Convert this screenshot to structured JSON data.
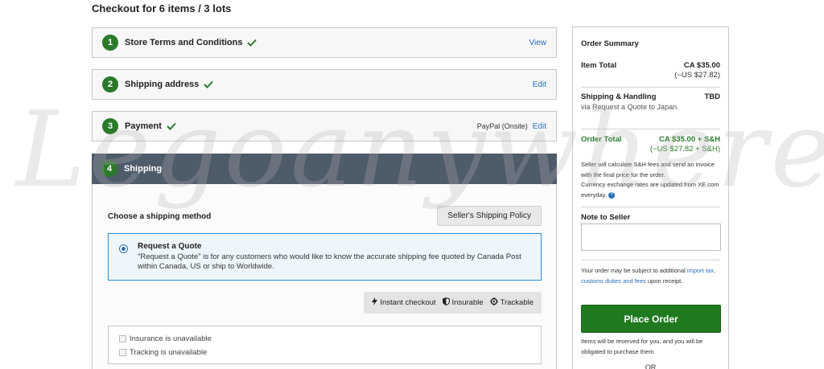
{
  "page": {
    "title": "Checkout for 6 items / 3 lots"
  },
  "steps": [
    {
      "num": "1",
      "label": "Store Terms and Conditions",
      "extra": "",
      "link": "View"
    },
    {
      "num": "2",
      "label": "Shipping address",
      "extra": "",
      "link": "Edit"
    },
    {
      "num": "3",
      "label": "Payment",
      "extra": "PayPal (Onsite)",
      "link": "Edit"
    },
    {
      "num": "4",
      "label": "Shipping"
    }
  ],
  "shipping": {
    "choose_label": "Choose a shipping method",
    "policy_button": "Seller's Shipping Policy",
    "option": {
      "title": "Request a Quote",
      "description": "\"Request a Quote\" is for any customers who would like to know the accurate shipping fee quoted by Canada Post within Canada, US or ship to Worldwide."
    },
    "badges": [
      "Instant checkout",
      "Insurable",
      "Trackable"
    ],
    "unavailable": [
      "Insurance is unavailable",
      "Tracking is unavailable"
    ]
  },
  "summary": {
    "title": "Order Summary",
    "item_total_label": "Item Total",
    "item_total_value": "CA $35.00",
    "item_total_usd": "(~US $27.82)",
    "sh_label": "Shipping & Handling",
    "sh_value": "TBD",
    "sh_note": "via Request a Quote to Japan.",
    "order_total_label": "Order Total",
    "order_total_value": "CA $35.00 + S&H",
    "order_total_usd": "(~US $27.82 + S&H)",
    "fees_note": "Seller will calculate S&H fees and send an invoice with the final price for the order.",
    "currency_note": "Currency exchange rates are updated from XE.com everyday.",
    "note_label": "Note to Seller",
    "duties_prefix": "Your order may be subject to additional",
    "duties_link": "import tax, customs duties and fees",
    "duties_suffix": "upon receipt.",
    "place_order": "Place Order",
    "reserved_note": "Items will be reserved for you, and you will be obligated to purchase them.",
    "or_text": "OR"
  },
  "watermark": "Legoanywhere",
  "colors": {
    "accent_green": "#2b7a2b",
    "link_blue": "#2a6eb8",
    "active_step_bg": "#4e5b68"
  }
}
